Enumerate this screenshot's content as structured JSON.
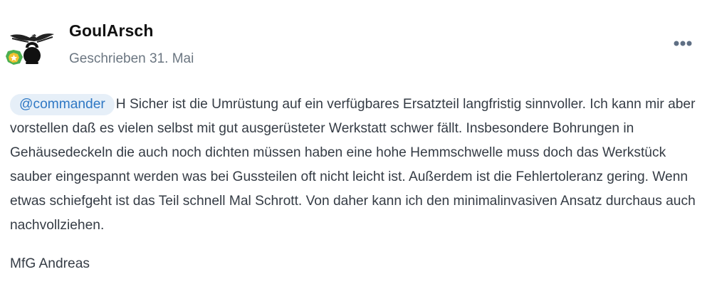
{
  "post": {
    "author": "GoulArsch",
    "date": "Geschrieben 31. Mai",
    "mention": "@commander",
    "body": "H Sicher ist die Umrüstung auf ein verfügbares Ersatzteil langfristig sinnvoller. Ich kann mir aber vorstellen daß es vielen selbst mit gut ausgerüsteter Werkstatt schwer fällt. Insbesondere Bohrungen in Gehäusedeckeln die auch noch dichten müssen haben eine hohe Hemmschwelle muss doch das Werkstück sauber eingespannt werden was bei Gussteilen oft nicht leicht ist. Außerdem ist die Fehlertoleranz gering. Wenn etwas schiefgeht ist das Teil schnell Mal Schrott. Von daher kann ich den minimalinvasiven Ansatz durchaus auch nachvollziehen.",
    "signature": "MfG Andreas"
  },
  "icons": {
    "avatar": "eagle-kettlebell-avatar",
    "badge": "star-rank-badge-icon",
    "more": "more-horizontal-icon"
  },
  "colors": {
    "mention_bg": "#e6eff8",
    "mention_text": "#2f78c4",
    "badge_green": "#4caf50",
    "badge_yellow": "#f2c230"
  }
}
